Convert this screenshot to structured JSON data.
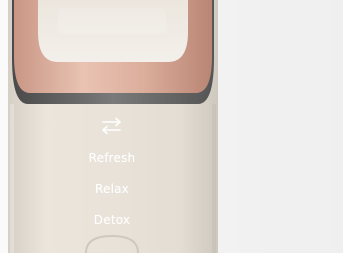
{
  "device": {
    "name": "",
    "body_color": "#e9e3da",
    "accent_color": "#d9ac9c",
    "rim_color": "#6e6e6e",
    "icon": "swap-arrows-icon"
  },
  "modes": [
    {
      "label": "Refresh"
    },
    {
      "label": "Relax"
    },
    {
      "label": "Detox"
    }
  ]
}
